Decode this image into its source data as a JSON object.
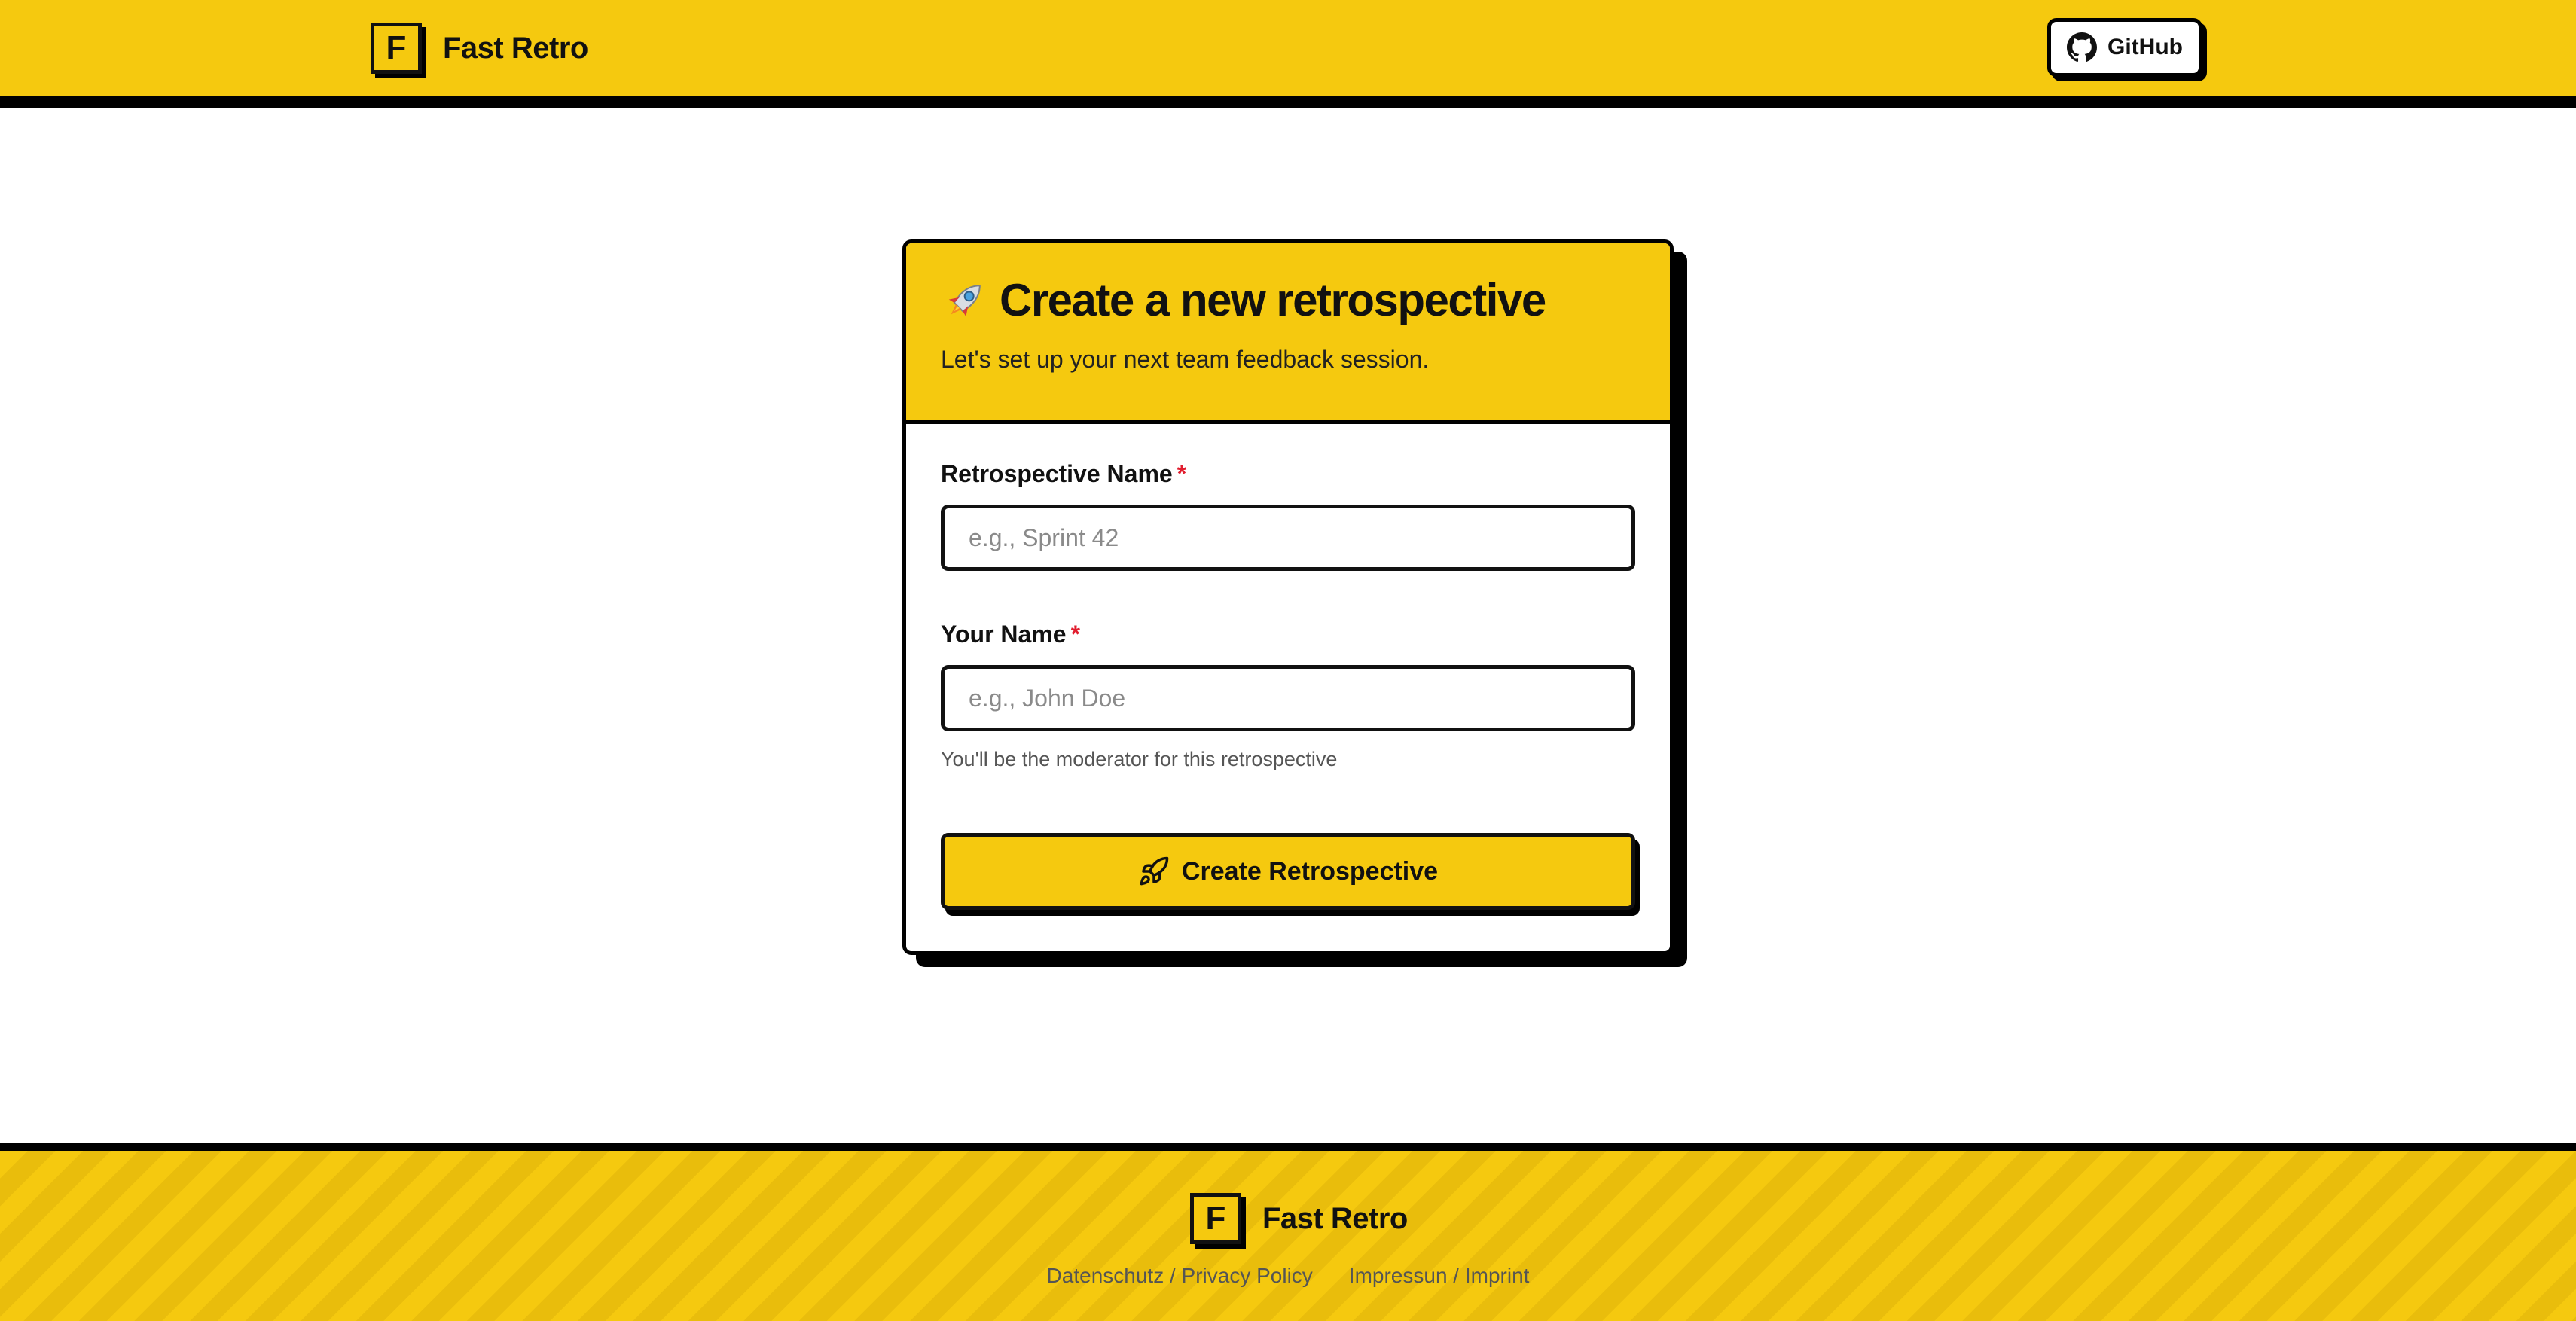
{
  "header": {
    "logo_letter": "F",
    "brand_name": "Fast Retro",
    "github_label": "GitHub",
    "github_icon": "github-icon"
  },
  "card": {
    "title_icon": "rocket-icon",
    "title": "Create a new retrospective",
    "subtitle": "Let's set up your next team feedback session.",
    "fields": [
      {
        "label": "Retrospective Name",
        "required_mark": "*",
        "placeholder": "e.g., Sprint 42",
        "value": ""
      },
      {
        "label": "Your Name",
        "required_mark": "*",
        "placeholder": "e.g., John Doe",
        "value": "",
        "help": "You'll be the moderator for this retrospective"
      }
    ],
    "submit_label": "Create Retrospective",
    "submit_icon": "rocket-outline-icon"
  },
  "footer": {
    "logo_letter": "F",
    "brand_name": "Fast Retro",
    "links": [
      {
        "label": "Datenschutz / Privacy Policy"
      },
      {
        "label": "Impressun / Imprint"
      }
    ]
  },
  "colors": {
    "accent_yellow": "#f5c90f",
    "border_black": "#000000",
    "required_red": "#e11d2e",
    "muted_text": "#555555"
  }
}
